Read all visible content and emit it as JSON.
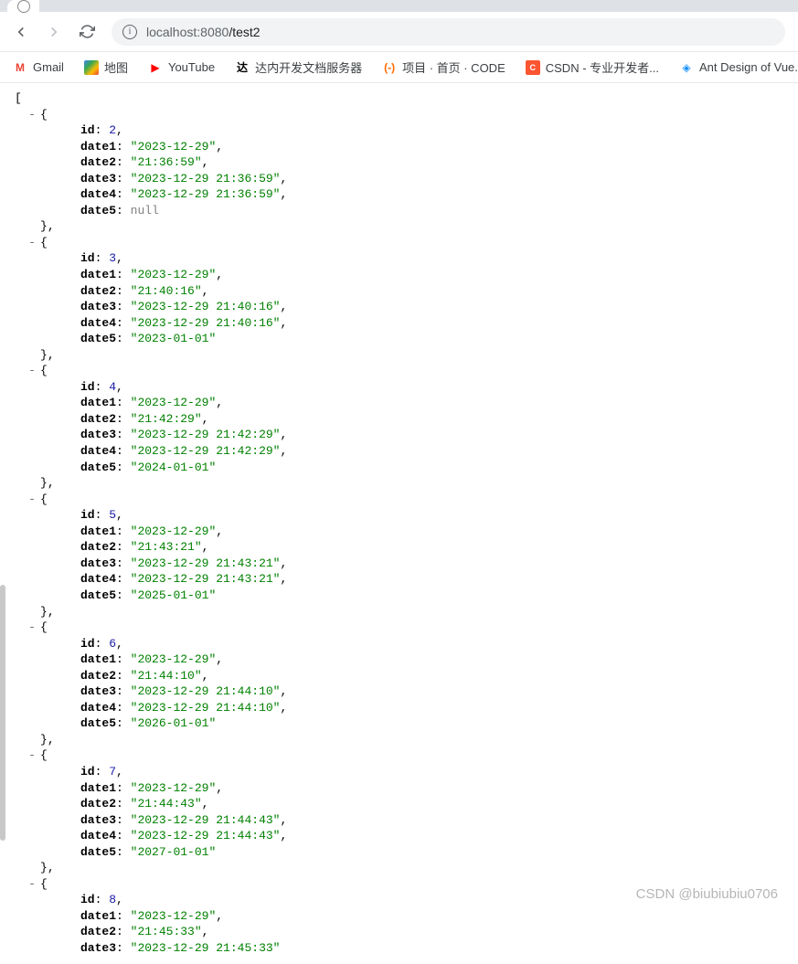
{
  "url": {
    "host": "localhost:",
    "port": "8080",
    "path": "/test2"
  },
  "bookmarks": [
    {
      "label": "Gmail",
      "icon": "gmail"
    },
    {
      "label": "地图",
      "icon": "maps"
    },
    {
      "label": "YouTube",
      "icon": "youtube"
    },
    {
      "label": "达内开发文档服务器",
      "icon": "da"
    },
    {
      "label": "项目 · 首页 · CODE",
      "icon": "code"
    },
    {
      "label": "CSDN - 专业开发者...",
      "icon": "csdn"
    },
    {
      "label": "Ant Design of Vue...",
      "icon": "ant"
    }
  ],
  "json_data": [
    {
      "id": 2,
      "date1": "2023-12-29",
      "date2": "21:36:59",
      "date3": "2023-12-29 21:36:59",
      "date4": "2023-12-29 21:36:59",
      "date5": null
    },
    {
      "id": 3,
      "date1": "2023-12-29",
      "date2": "21:40:16",
      "date3": "2023-12-29 21:40:16",
      "date4": "2023-12-29 21:40:16",
      "date5": "2023-01-01"
    },
    {
      "id": 4,
      "date1": "2023-12-29",
      "date2": "21:42:29",
      "date3": "2023-12-29 21:42:29",
      "date4": "2023-12-29 21:42:29",
      "date5": "2024-01-01"
    },
    {
      "id": 5,
      "date1": "2023-12-29",
      "date2": "21:43:21",
      "date3": "2023-12-29 21:43:21",
      "date4": "2023-12-29 21:43:21",
      "date5": "2025-01-01"
    },
    {
      "id": 6,
      "date1": "2023-12-29",
      "date2": "21:44:10",
      "date3": "2023-12-29 21:44:10",
      "date4": "2023-12-29 21:44:10",
      "date5": "2026-01-01"
    },
    {
      "id": 7,
      "date1": "2023-12-29",
      "date2": "21:44:43",
      "date3": "2023-12-29 21:44:43",
      "date4": "2023-12-29 21:44:43",
      "date5": "2027-01-01"
    },
    {
      "id": 8,
      "date1": "2023-12-29",
      "date2": "21:45:33",
      "date3": "2023-12-29 21:45:33"
    }
  ],
  "watermark": "CSDN @biubiubiu0706"
}
